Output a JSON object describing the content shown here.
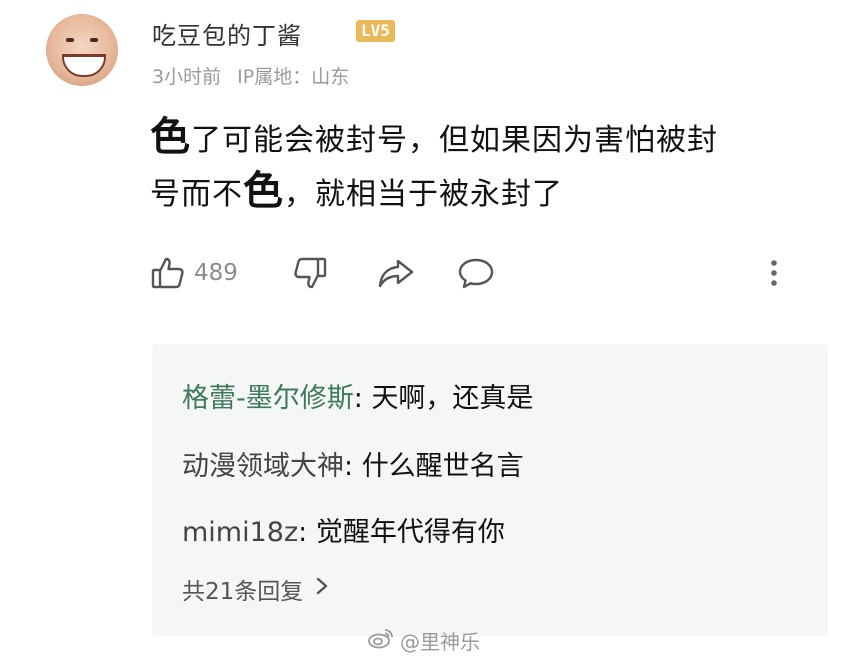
{
  "comment": {
    "username": "吃豆包的丁酱",
    "level": "LV5",
    "time": "3小时前",
    "location_label": "IP属地：山东",
    "content": {
      "p1_big": "色",
      "p1_rest": "了可能会被封号，但如果因为害怕被封",
      "p2_pre": "号而不",
      "p2_big": "色",
      "p2_post": "，就相当于被永封了"
    },
    "likes": "489"
  },
  "replies": [
    {
      "name": "格蕾-墨尔修斯",
      "text": "天啊，还真是"
    },
    {
      "name": "动漫领域大神",
      "text": "什么醒世名言"
    },
    {
      "name": "mimi18z",
      "text": "觉醒年代得有你"
    }
  ],
  "more_replies": "共21条回复",
  "watermark": "@里神乐",
  "colors": {
    "badge": "#e9b95a",
    "reply_bg": "#f5f6f6",
    "meta_text": "#9a9a9a"
  },
  "icons": [
    "like-icon",
    "dislike-icon",
    "share-icon",
    "comment-icon",
    "more-icon",
    "chevron-right-icon",
    "weibo-icon"
  ]
}
